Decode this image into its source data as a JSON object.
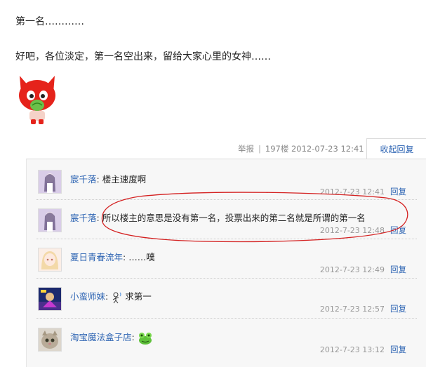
{
  "post": {
    "line1": "第一名…………",
    "line2": "好吧，各位淡定，第一名空出来，留给大家心里的女神……"
  },
  "floor": {
    "report": "举报",
    "separator": "|",
    "floor_no": "197楼",
    "time": "2012-07-23 12:41",
    "collapse_label": "收起回复"
  },
  "replies": [
    {
      "user": "宸千落",
      "text": "楼主速度啊",
      "time": "2012-7-23 12:41",
      "reply": "回复",
      "avatar": "anime-girl-purple-avatar"
    },
    {
      "user": "宸千落",
      "text": "所以楼主的意思是没有第一名，投票出来的第二名就是所谓的第一名",
      "time": "2012-7-23 12:48",
      "reply": "回复",
      "avatar": "anime-girl-purple-avatar"
    },
    {
      "user": "夏日青春流年",
      "text": "……噗",
      "time": "2012-7-23 12:49",
      "reply": "回复",
      "avatar": "anime-girl-blonde-avatar"
    },
    {
      "user": "小蛮师妹",
      "text": "求第一",
      "time": "2012-7-23 12:57",
      "reply": "回复",
      "avatar": "game-character-avatar",
      "emoji": "sweat-stick-figure-emoticon"
    },
    {
      "user": "淘宝魔法盒子店",
      "text": "",
      "time": "2012-7-23 13:12",
      "reply": "回复",
      "avatar": "cat-avatar",
      "emoji": "green-frog-emoticon"
    }
  ],
  "annotation": {
    "color": "#d42020"
  }
}
